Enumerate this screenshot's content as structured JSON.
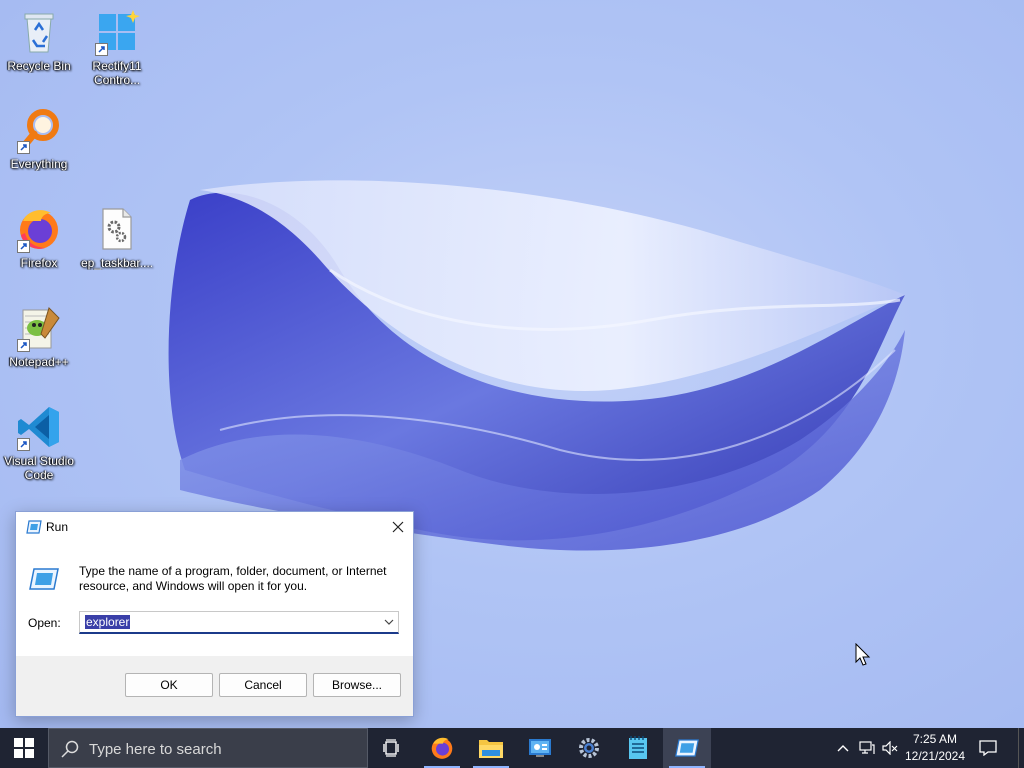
{
  "desktop": {
    "icons": [
      {
        "name": "recycle-bin",
        "label": "Recycle Bin",
        "label2": ""
      },
      {
        "name": "rectify11",
        "label": "Rectify11",
        "label2": "Contro..."
      },
      {
        "name": "everything",
        "label": "Everything",
        "label2": ""
      },
      {
        "name": "firefox",
        "label": "Firefox",
        "label2": ""
      },
      {
        "name": "ep-taskbar",
        "label": "ep_taskbar....",
        "label2": ""
      },
      {
        "name": "notepad-plus-plus",
        "label": "Notepad++",
        "label2": ""
      },
      {
        "name": "vscode",
        "label": "Visual Studio",
        "label2": "Code"
      }
    ]
  },
  "run_dialog": {
    "title": "Run",
    "description": "Type the name of a program, folder, document, or Internet resource, and Windows will open it for you.",
    "open_label": "Open:",
    "open_value": "explorer",
    "ok_label": "OK",
    "cancel_label": "Cancel",
    "browse_label": "Browse..."
  },
  "taskbar": {
    "search_placeholder": "Type here to search",
    "apps": [
      "task-view",
      "firefox",
      "file-explorer",
      "control-panel",
      "settings",
      "notepad",
      "run"
    ],
    "active_app": "run",
    "time": "7:25 AM",
    "date": "12/21/2024"
  },
  "colors": {
    "taskbar_bg": "#1f2433",
    "accent": "#3a3fa8",
    "wallpaper": "#a9bff5"
  }
}
